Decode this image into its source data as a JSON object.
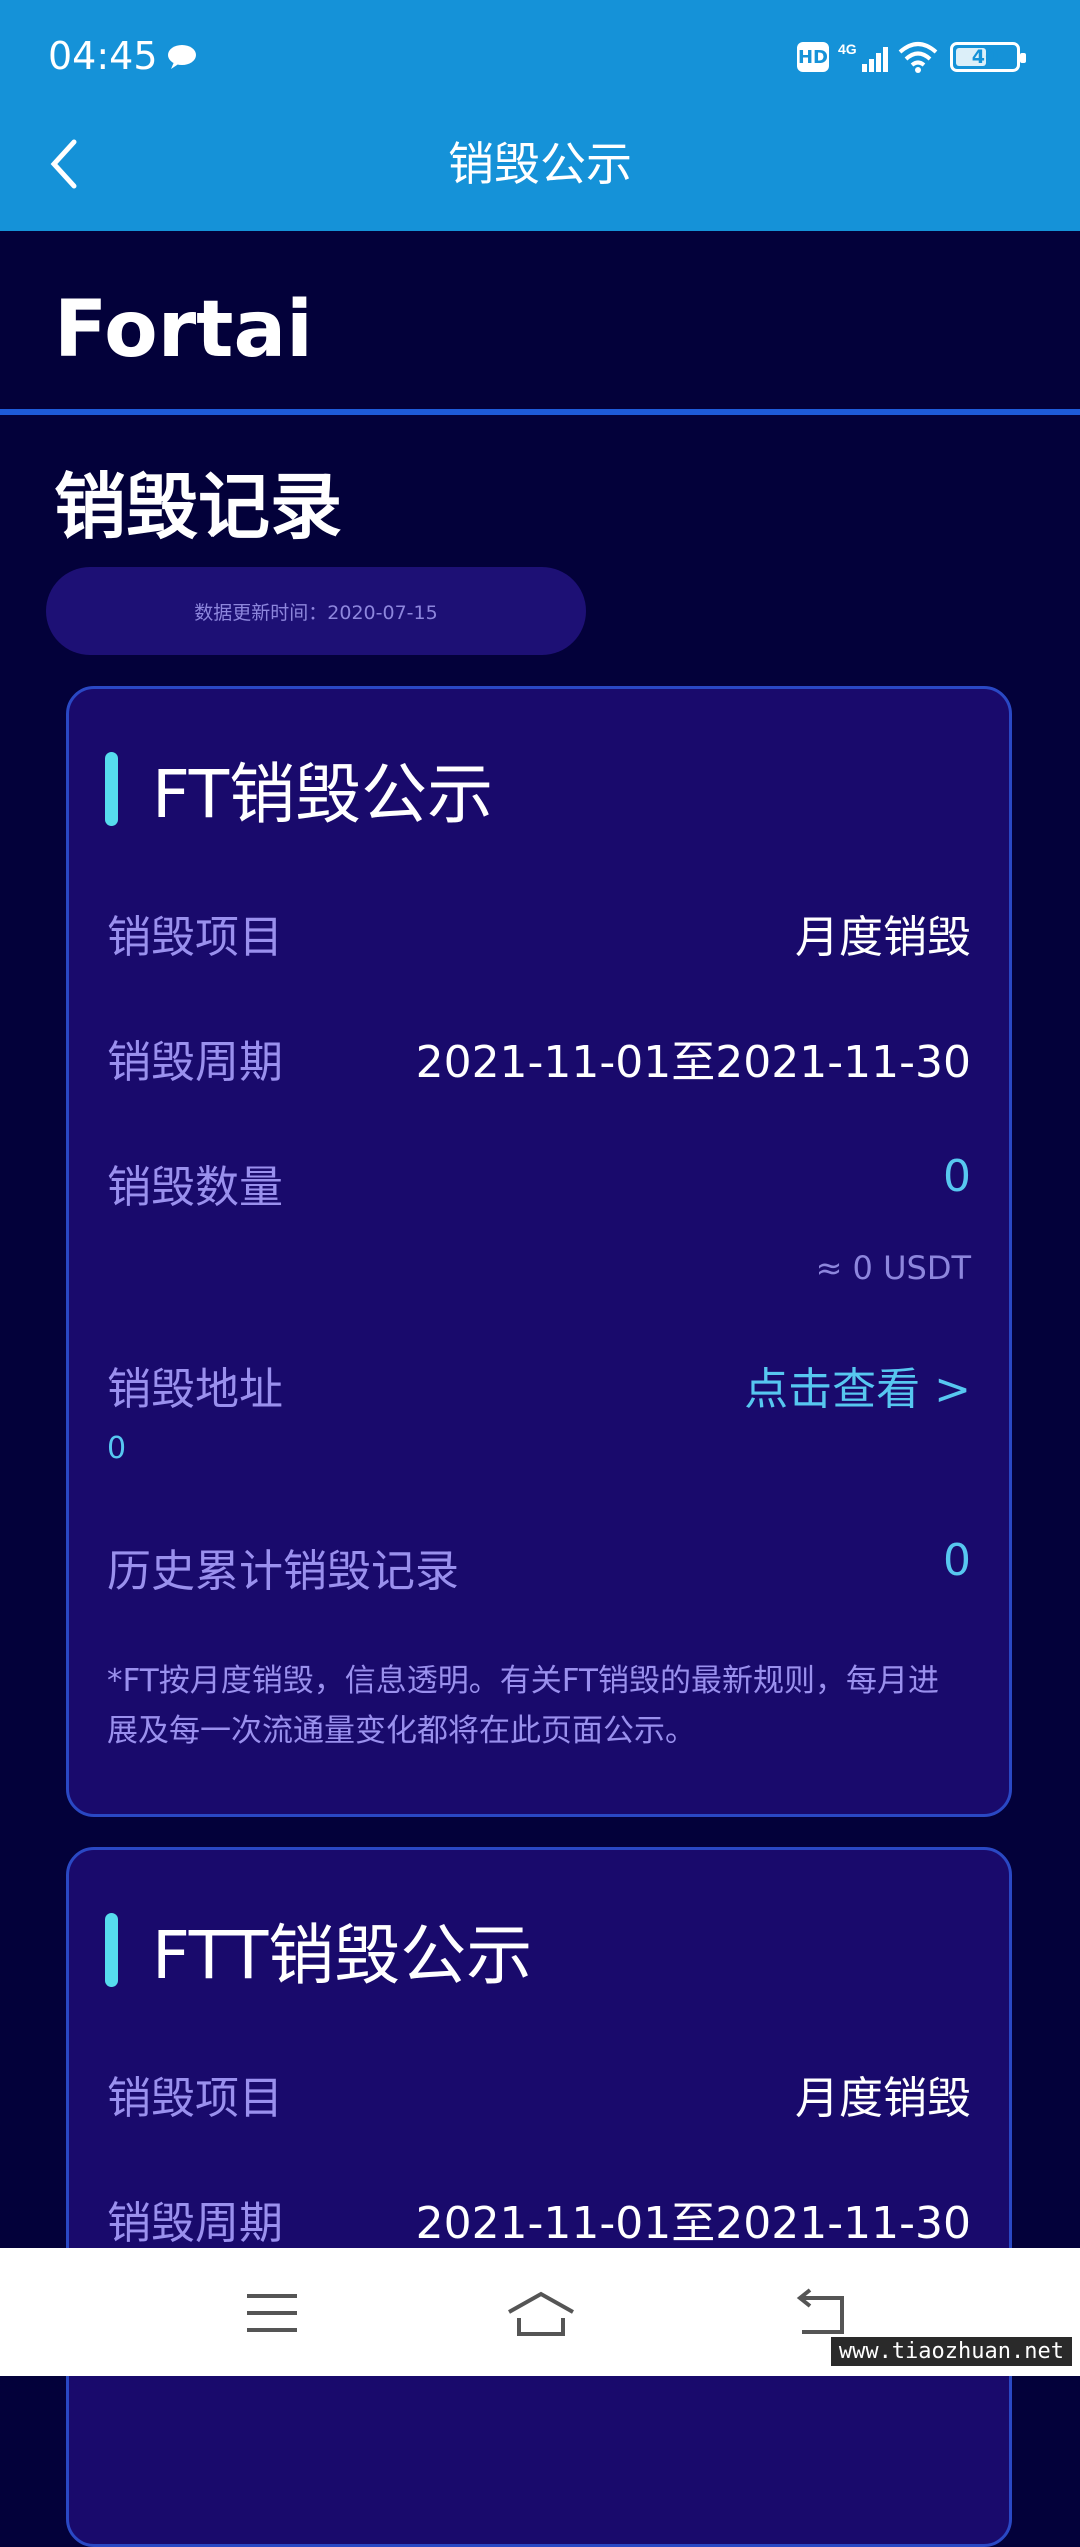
{
  "status_bar": {
    "time": "04:45",
    "hd_label": "HD",
    "network": "4G",
    "battery": "40",
    "icons": [
      "chat-bubble-icon",
      "signal-icon",
      "wifi-icon",
      "battery-icon"
    ]
  },
  "header": {
    "title": "销毁公示",
    "back_icon": "chevron-left-icon"
  },
  "brand": "Fortai",
  "section_title": "销毁记录",
  "update_time": "数据更新时间：2020-07-15",
  "cards": [
    {
      "title": "FT销毁公示",
      "item_label": "销毁项目",
      "item_value": "月度销毁",
      "period_label": "销毁周期",
      "period_value": "2021-11-01至2021-11-30",
      "amount_label": "销毁数量",
      "amount_value": "0",
      "amount_usdt": "≈ 0 USDT",
      "address_label": "销毁地址",
      "address_link": "点击查看 >",
      "address_value": "0",
      "history_label": "历史累计销毁记录",
      "history_value": "0",
      "note": "*FT按月度销毁，信息透明。有关FT销毁的最新规则，每月进展及每一次流通量变化都将在此页面公示。"
    },
    {
      "title": "FTT销毁公示",
      "item_label": "销毁项目",
      "item_value": "月度销毁",
      "period_label": "销毁周期",
      "period_value": "2021-11-01至2021-11-30"
    }
  ],
  "nav_bar": {
    "icons": [
      "menu-icon",
      "home-icon",
      "back-icon"
    ]
  },
  "watermark": "www.tiaozhuan.net",
  "colors": {
    "header": "#1592d8",
    "background": "#03013a",
    "card": "#190a6c",
    "accent": "#57c7f0",
    "label": "#9a90ee"
  }
}
